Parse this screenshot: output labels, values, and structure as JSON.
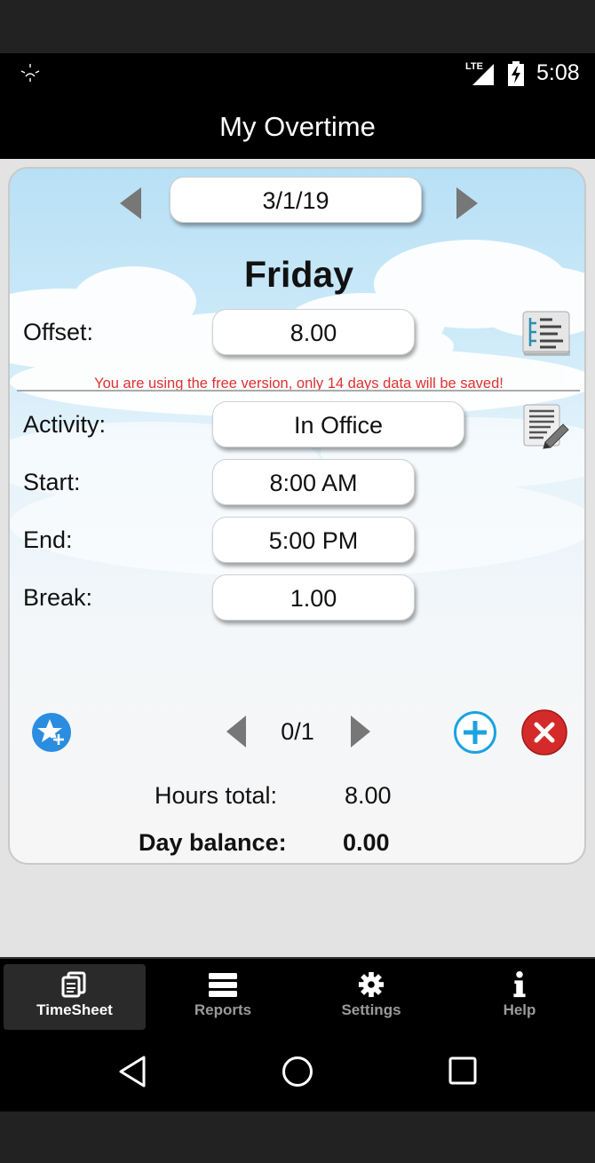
{
  "status_bar": {
    "network": "LTE",
    "time": "5:08"
  },
  "app_bar": {
    "title": "My Overtime"
  },
  "timesheet": {
    "date": "3/1/19",
    "weekday": "Friday",
    "offset_label": "Offset:",
    "offset_value": "8.00",
    "warning": "You are using the free version, only 14 days data will be saved!",
    "activity_label": "Activity:",
    "activity_value": "In Office",
    "start_label": "Start:",
    "start_value": "8:00 AM",
    "end_label": "End:",
    "end_value": "5:00 PM",
    "break_label": "Break:",
    "break_value": "1.00",
    "entry_pager": "0/1",
    "hours_total_label": "Hours total:",
    "hours_total_value": "8.00",
    "day_balance_label": "Day balance:",
    "day_balance_value": "0.00"
  },
  "bottom_nav": {
    "active": "TimeSheet",
    "items": [
      {
        "label": "TimeSheet",
        "icon": "timesheet-icon"
      },
      {
        "label": "Reports",
        "icon": "reports-icon"
      },
      {
        "label": "Settings",
        "icon": "settings-icon"
      },
      {
        "label": "Help",
        "icon": "help-icon"
      }
    ]
  },
  "colors": {
    "accent_add": "#1aa3e0",
    "delete_red": "#d42a2a",
    "favorite_blue": "#2b8de0",
    "warning_red": "#e03030"
  }
}
